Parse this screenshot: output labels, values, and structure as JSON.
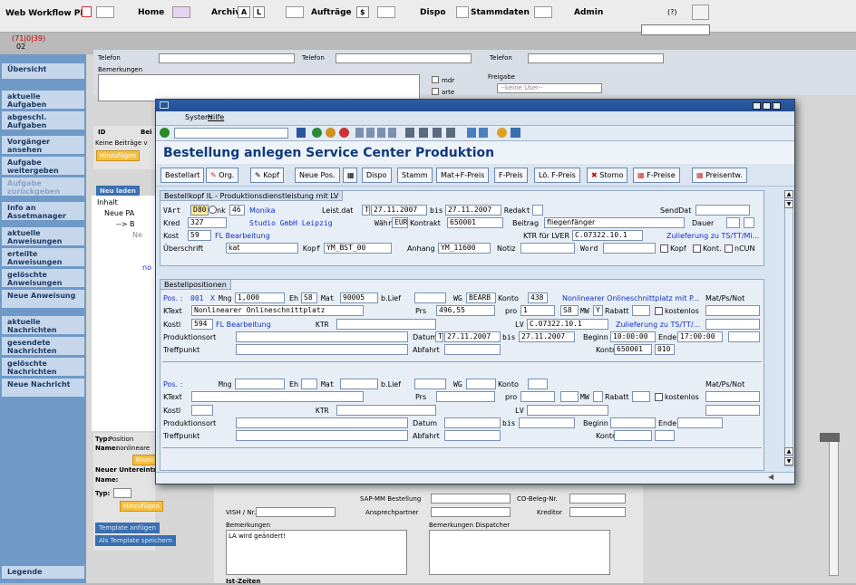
{
  "app": {
    "title": "Web Workflow PPS",
    "counter": "(71|0|39)",
    "counter_sub": "02",
    "help": "(?)"
  },
  "nav": {
    "home": "Home",
    "archiv": "Archiv",
    "a": "A",
    "l": "L",
    "auftraege": "Aufträge",
    "dollar": "$",
    "dispo": "Dispo",
    "stammdaten": "Stammdaten",
    "admin": "Admin"
  },
  "sidebar": {
    "items": [
      "Übersicht",
      "aktuelle Aufgaben",
      "abgeschl. Aufgaben",
      "Vorgänger ansehen",
      "Aufgabe weitergeben",
      "Aufgabe zurückgeben",
      "Info an Assetmanager",
      "aktuelle Anweisungen",
      "erteilte Anweisungen",
      "gelöschte Anweisungen",
      "Neue Anweisung",
      "aktuelle Nachrichten",
      "gesendete Nachrichten",
      "gelöschte Nachrichten",
      "Neue Nachricht",
      "Legende"
    ]
  },
  "bg": {
    "telefon": "Telefon",
    "bemerkungen": "Bemerkungen",
    "mdr": "mdr",
    "arte": "arte",
    "freigabe": "Freigabe",
    "keine_user": "--keine User--",
    "id": "ID",
    "bei": "Bei",
    "keine_beitraege": "Keine Beiträge v",
    "hinzufuegen": "Hinzufügen",
    "neu_laden": "Neu laden",
    "inhalt": "Inhalt",
    "neue_pa": "Neue PA",
    "tree2": "--> B",
    "tree3": "Ne",
    "tree4": "no",
    "typ": "Typ:",
    "position": "Position",
    "name": "Name:",
    "nonlineare": "nonlineare",
    "knoten": "Knoten",
    "neuer_unter": "Neuer Untereintra",
    "name2": "Name:",
    "typ2": "Typ:",
    "hinzu2": "Hinzufügen",
    "tpl1": "Template anfügen",
    "tpl2": "Als Template speichern",
    "sap_best": "SAP-MM Bestellung",
    "co_beleg": "CO-Beleg-Nr.",
    "vish": "VISH / Nr.",
    "ansprech": "Ansprechpartner",
    "kreditor": "Kreditor",
    "bemerk2": "Bemerkungen",
    "bemerk_disp": "Bemerkungen Dispatcher",
    "la_text": "LA wird geändert!",
    "istzeiten": "Ist-Zeiten"
  },
  "dialog": {
    "menu": {
      "system": "System",
      "hilfe": "Hilfe"
    },
    "title": "Bestellung anlegen Service Center Produktion",
    "buttons": [
      "Bestellart",
      "Org.",
      "Kopf",
      "Neue Pos.",
      "Dispo",
      "Stamm",
      "Mat+F-Preis",
      "F-Preis",
      "Lö. F-Preis",
      "Storno",
      "F-Preise",
      "Preisentw."
    ],
    "kopf": {
      "title": "Bestellkopf IL - Produktionsdienstleistung mit LV",
      "vart_l": "VArt",
      "vart": "D80",
      "link_l": "nk",
      "link": "46",
      "user": "Monika",
      "leistdat_l": "Leist.dat",
      "leist_t": "T",
      "leist_from": "27.11.2007",
      "bis_l": "bis",
      "leist_to": "27.11.2007",
      "redakt_l": "Redakt",
      "sendat_l": "SendDat",
      "kred_l": "Kred",
      "kred": "327",
      "kred_name": "Studio GmbH Leipzig",
      "waehr_l": "Währ",
      "waehr": "EUR",
      "kontrakt_l": "Kontrakt",
      "kontrakt": "650001",
      "beitrag_l": "Beitrag",
      "beitrag": "fliegenfänger",
      "dauer_l": "Dauer",
      "kost_l": "Kost",
      "kost": "59",
      "kost_name": "FL Bearbeitung",
      "ktr_lv_l": "KTR für LVER",
      "ktr_lv": "C.07322.10.1",
      "zulief": "Zulieferung zu TS/TT/Mi...",
      "ueber_l": "Überschrift",
      "ueber": "kat",
      "kopf_l": "Kopf",
      "kopf": "YM_BST_00",
      "anhang_l": "Anhang",
      "anhang": "YM_11600",
      "notiz_l": "Notiz",
      "word_l": "Word",
      "cb_kopf": "Kopf",
      "cb_kont": "Kont.",
      "cb_ncun": "nCUN"
    },
    "pos": {
      "title": "Bestellpositionen",
      "pos_l": "Pos. :",
      "pos": "001",
      "x": "X",
      "mng_l": "Mng",
      "mng": "1,000",
      "eh_l": "Eh",
      "eh": "S8",
      "mat_l": "Mat",
      "mat": "90005",
      "blief_l": "b.Lief",
      "wg_l": "WG",
      "wg": "BEARB",
      "konto_l": "Konto",
      "konto": "438",
      "konto_name": "Nonlinearer Onlineschnittplatz mit P...",
      "matps_l": "Mat/Ps/Not",
      "ktext_l": "KText",
      "ktext": "Nonlinearer Onlineschnittplatz",
      "prs_l": "Prs",
      "prs": "496,55",
      "pro_l": "pro",
      "pro": "1",
      "pro_eh": "S8",
      "mw_l": "MW",
      "mw": "Y",
      "rabatt_l": "Rabatt",
      "kostenlos_l": "kostenlos",
      "kostl_l": "Kostl",
      "kostl": "594",
      "kostl_name": "FL Bearbeitung",
      "ktr_l": "KTR",
      "lv_l": "LV",
      "lv": "C.07322.10.1",
      "zulief2": "Zulieferung zu TS/TT/...",
      "prodort_l": "Produktionsort",
      "datum_l": "Datum",
      "datum_t": "T",
      "datum_from": "27.11.2007",
      "bis2_l": "bis",
      "datum_to": "27.11.2007",
      "beginn_l": "Beginn",
      "beginn": "10:00:00",
      "ende_l": "Ende",
      "ende": "17:00:00",
      "treff_l": "Treffpunkt",
      "abfahrt_l": "Abfahrt",
      "kontr_l": "Kontr",
      "kontr": "650001",
      "kontr2": "010"
    }
  },
  "colors": {
    "sidebar": "#6f9ac8",
    "title": "#0e3a7c",
    "link": "#1030c8"
  }
}
